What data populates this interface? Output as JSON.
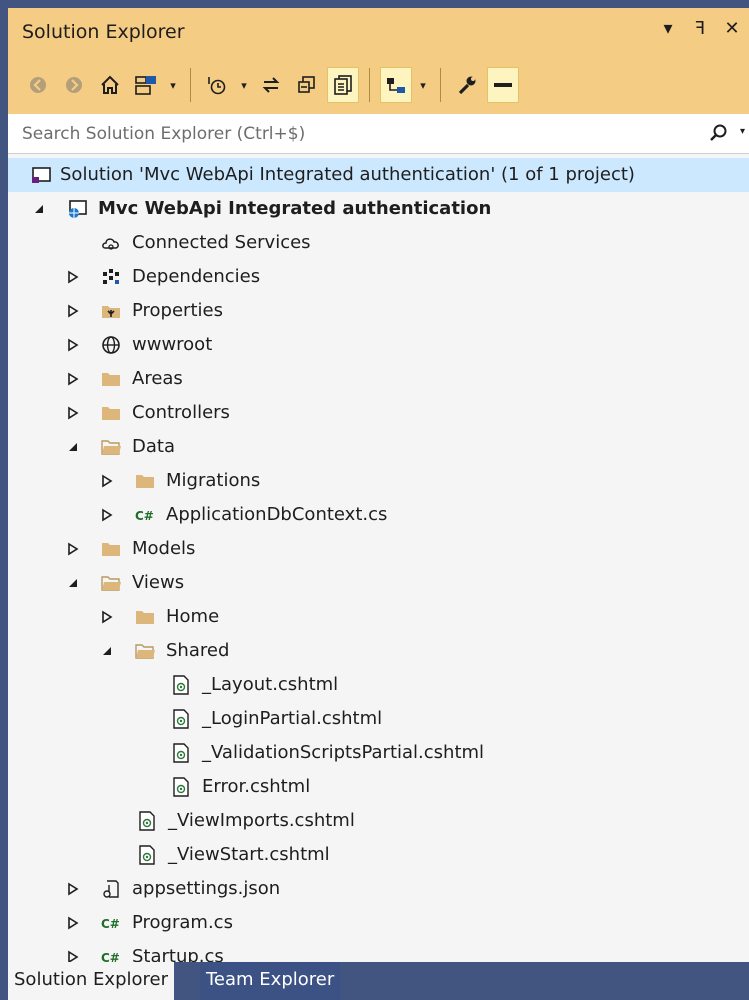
{
  "window": {
    "title": "Solution Explorer",
    "controls": [
      "▾",
      "ꟻ",
      "✕"
    ]
  },
  "search": {
    "placeholder": "Search Solution Explorer (Ctrl+$)"
  },
  "tree": {
    "solution": "Solution 'Mvc WebApi Integrated authentication' (1 of 1 project)",
    "project": "Mvc WebApi Integrated authentication",
    "items": {
      "connected_services": "Connected Services",
      "dependencies": "Dependencies",
      "properties": "Properties",
      "wwwroot": "wwwroot",
      "areas": "Areas",
      "controllers": "Controllers",
      "data": "Data",
      "migrations": "Migrations",
      "appdbcontext": "ApplicationDbContext.cs",
      "models": "Models",
      "views": "Views",
      "home": "Home",
      "shared": "Shared",
      "layout": "_Layout.cshtml",
      "loginpartial": "_LoginPartial.cshtml",
      "validation": "_ValidationScriptsPartial.cshtml",
      "error": "Error.cshtml",
      "viewimports": "_ViewImports.cshtml",
      "viewstart": "_ViewStart.cshtml",
      "appsettings": "appsettings.json",
      "program": "Program.cs",
      "startup": "Startup.cs"
    }
  },
  "tabs": {
    "solution_explorer": "Solution Explorer",
    "team_explorer": "Team Explorer"
  },
  "colors": {
    "accent": "#f5cc84",
    "selection": "#cce8ff",
    "frame": "#425480",
    "folder": "#dcb67a"
  }
}
